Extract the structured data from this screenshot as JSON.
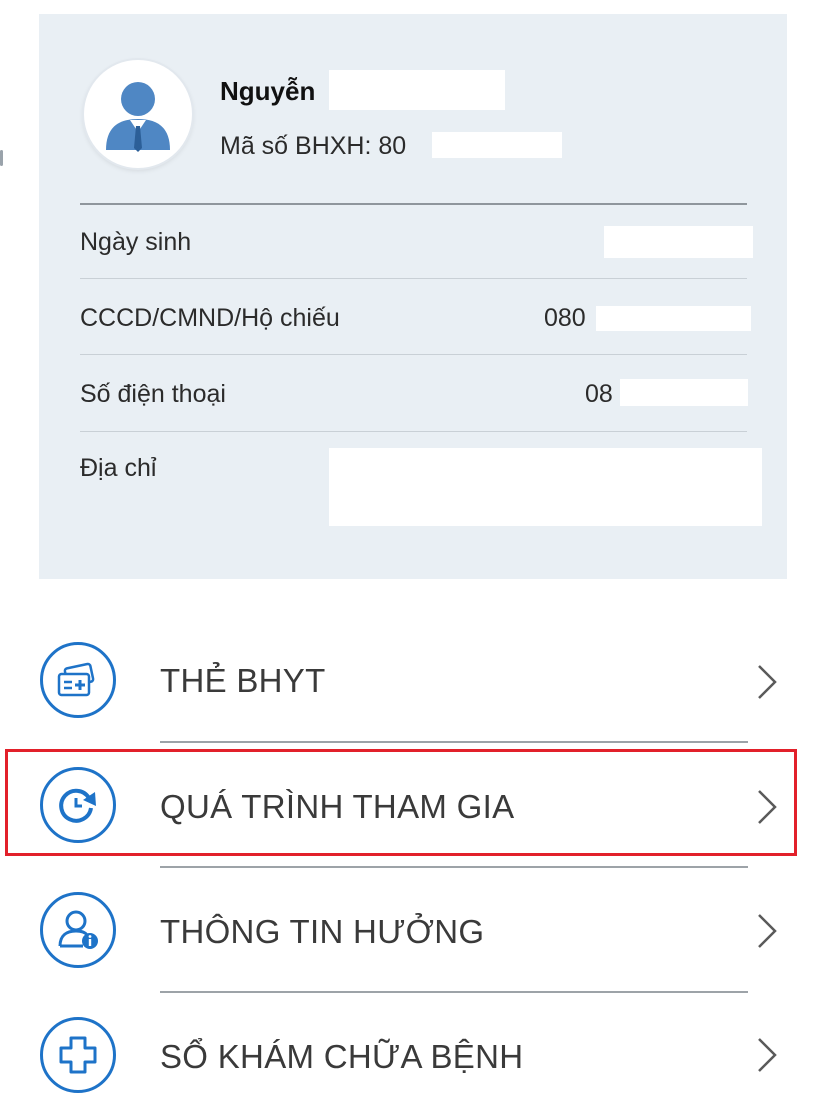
{
  "profile": {
    "name": "Nguyễn",
    "bhxh_label": "Mã số BHXH: 80",
    "avatar_icon": "user-avatar-icon",
    "rows": [
      {
        "label": "Ngày sinh",
        "value": ""
      },
      {
        "label": "CCCD/CMND/Hộ chiếu",
        "value": "080"
      },
      {
        "label": "Số điện thoại",
        "value": "08"
      },
      {
        "label": "Địa chỉ",
        "value": ""
      }
    ]
  },
  "menu": {
    "items": [
      {
        "label": "THẺ BHYT",
        "icon": "health-card-icon"
      },
      {
        "label": "QUÁ TRÌNH THAM GIA",
        "icon": "history-clock-icon",
        "highlighted": true
      },
      {
        "label": "THÔNG TIN HƯỞNG",
        "icon": "user-info-icon"
      },
      {
        "label": "SỔ KHÁM CHỮA BỆNH",
        "icon": "medical-cross-icon"
      }
    ]
  },
  "colors": {
    "card_bg": "#e9eff4",
    "accent_blue": "#1e73c8",
    "highlight_red": "#e2202a"
  }
}
